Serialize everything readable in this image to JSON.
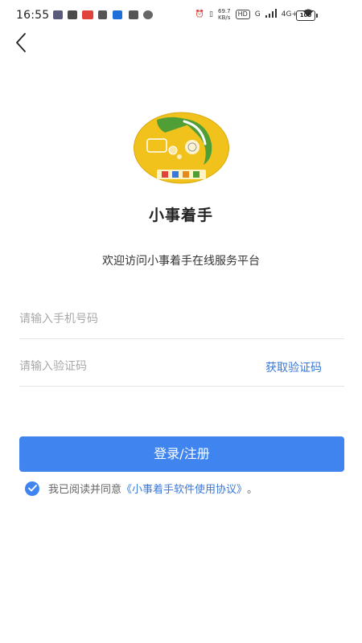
{
  "status_bar": {
    "time": "16:55",
    "net_speed": "69.7",
    "net_unit": "KB/s",
    "hd_label": "HD",
    "sim_label": "G",
    "network_label": "4G+",
    "battery": "100"
  },
  "header": {
    "back_icon": "chevron-left-icon"
  },
  "app": {
    "name": "小事着手",
    "welcome": "欢迎访问小事着手在线服务平台",
    "logo_caption": "小事着手",
    "logo_icon": "app-logo"
  },
  "form": {
    "phone_placeholder": "请输入手机号码",
    "code_placeholder": "请输入验证码",
    "get_code_label": "获取验证码",
    "submit_label": "登录/注册",
    "agreement_prefix": "我已阅读并同意",
    "agreement_link": "《小事着手软件使用协议》",
    "agreement_suffix": "。",
    "agreed": true
  },
  "colors": {
    "accent": "#3f84ef",
    "link": "#3a78d8",
    "logo_bg": "#f2c21c",
    "logo_green": "#4f9f36"
  }
}
